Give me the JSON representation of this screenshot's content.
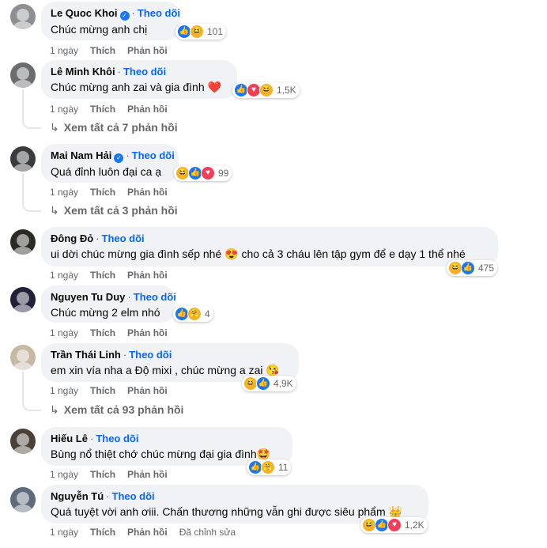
{
  "comments": [
    {
      "name": "Le Quoc Khoi",
      "verified": true,
      "follow": "Theo dõi",
      "text": "Chúc mừng anh chị",
      "time": "1 ngày",
      "like": "Thích",
      "reply": "Phản hồi",
      "reaction_count": "101",
      "reaction_icons": [
        "like-icon",
        "haha-icon"
      ]
    },
    {
      "name": "Lê Minh Khôi",
      "verified": false,
      "follow": "Theo dõi",
      "text": "Chúc mừng anh zai và gia đình ❤️",
      "time": "1 ngày",
      "like": "Thích",
      "reply": "Phản hồi",
      "reaction_count": "1,5K",
      "reaction_icons": [
        "like-icon",
        "love-icon",
        "haha-icon"
      ],
      "view_replies": "Xem tất cả 7 phản hồi"
    },
    {
      "name": "Mai Nam Hải",
      "verified": true,
      "follow": "Theo dõi",
      "text": "Quá đỉnh luôn đại ca ạ",
      "time": "1 ngày",
      "like": "Thích",
      "reply": "Phản hồi",
      "reaction_count": "99",
      "reaction_icons": [
        "haha-icon",
        "like-icon",
        "love-icon"
      ],
      "view_replies": "Xem tất cả 3 phản hồi"
    },
    {
      "name": "Đông Đỏ",
      "verified": false,
      "follow": "Theo dõi",
      "text": "ui dời chúc mừng gia đình sếp nhé 😍 cho cả 3 cháu lên tập gym để e dạy 1 thể nhé",
      "time": "1 ngày",
      "like": "Thích",
      "reply": "Phản hồi",
      "reaction_count": "475",
      "reaction_icons": [
        "haha-icon",
        "like-icon"
      ]
    },
    {
      "name": "Nguyen Tu Duy",
      "verified": false,
      "follow": "Theo dõi",
      "text": "Chúc mừng 2 elm nhó",
      "time": "1 ngày",
      "like": "Thích",
      "reply": "Phản hồi",
      "reaction_count": "4",
      "reaction_icons": [
        "like-icon",
        "care-icon"
      ]
    },
    {
      "name": "Trần Thái Linh",
      "verified": false,
      "follow": "Theo dõi",
      "text": "em xin vía nha a Độ mixi , chúc mừng a zai 😘",
      "time": "1 ngày",
      "like": "Thích",
      "reply": "Phản hồi",
      "reaction_count": "4,9K",
      "reaction_icons": [
        "haha-icon",
        "like-icon"
      ],
      "view_replies": "Xem tất cả 93 phản hồi"
    },
    {
      "name": "Hiếu Lê",
      "verified": false,
      "follow": "Theo dõi",
      "text": "Bùng nổ thiệt chớ chúc mừng đại gia đình🤩",
      "time": "1 ngày",
      "like": "Thích",
      "reply": "Phản hồi",
      "reaction_count": "11",
      "reaction_icons": [
        "like-icon",
        "care-icon"
      ]
    },
    {
      "name": "Nguyễn Tú",
      "verified": false,
      "follow": "Theo dõi",
      "text": "Quá tuyệt vời anh ơiii. Chấn thương những vẫn ghi được siêu phẩm 👑",
      "time": "1 ngày",
      "like": "Thích",
      "reply": "Phản hồi",
      "edited": "Đã chỉnh sửa",
      "reaction_count": "1,2K",
      "reaction_icons": [
        "haha-icon",
        "like-icon",
        "love-icon"
      ]
    }
  ],
  "colors": {
    "accent": "#0866ff",
    "bubble": "#f0f2f5",
    "muted": "#65676b",
    "like": "#1877f2",
    "love": "#f33e58",
    "haha": "#f7b125"
  }
}
